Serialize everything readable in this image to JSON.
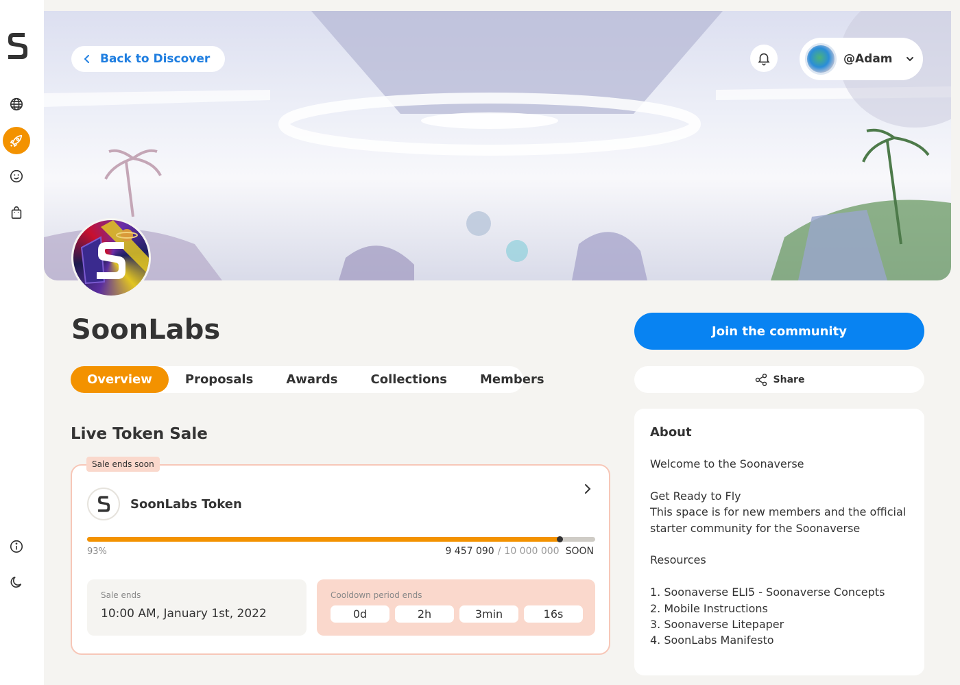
{
  "nav": {
    "back_label": "Back to Discover",
    "user_name": "@Adam"
  },
  "space": {
    "name": "SoonLabs"
  },
  "tabs": [
    {
      "label": "Overview",
      "active": true
    },
    {
      "label": "Proposals",
      "active": false
    },
    {
      "label": "Awards",
      "active": false
    },
    {
      "label": "Collections",
      "active": false
    },
    {
      "label": "Members",
      "active": false
    }
  ],
  "actions": {
    "join_label": "Join the community",
    "share_label": "Share"
  },
  "token_sale": {
    "section_title": "Live Token Sale",
    "badge": "Sale ends soon",
    "token_name": "SoonLabs Token",
    "progress_percent_label": "93%",
    "progress_fraction": 0.93,
    "sold": "9 457 090",
    "separator": "/",
    "total": "10 000 000",
    "symbol": "SOON",
    "sale_ends_label": "Sale ends",
    "sale_ends_value": "10:00 AM, January 1st, 2022",
    "cooldown_label": "Cooldown period ends",
    "cooldown": {
      "days": "0d",
      "hours": "2h",
      "minutes": "3min",
      "seconds": "16s"
    }
  },
  "about": {
    "title": "About",
    "welcome": "Welcome to the Soonaverse",
    "line1": "Get Ready to Fly",
    "line2": "This space is for new members and the official starter community for the Soonaverse",
    "resources_title": "Resources",
    "resources": [
      "1. Soonaverse ELI5 - Soonaverse Concepts",
      "2. Mobile Instructions",
      "3. Soonaverse Litepaper",
      "4. SoonLabs Manifesto"
    ]
  },
  "colors": {
    "accent_orange": "#f39200",
    "primary_blue": "#0883f2",
    "link_blue": "#1f7ee0",
    "badge_pink": "#fad8cc"
  },
  "icons": {
    "sidebar": [
      "globe-icon",
      "rocket-icon",
      "smiley-icon",
      "bag-icon",
      "info-icon",
      "moon-icon"
    ]
  }
}
